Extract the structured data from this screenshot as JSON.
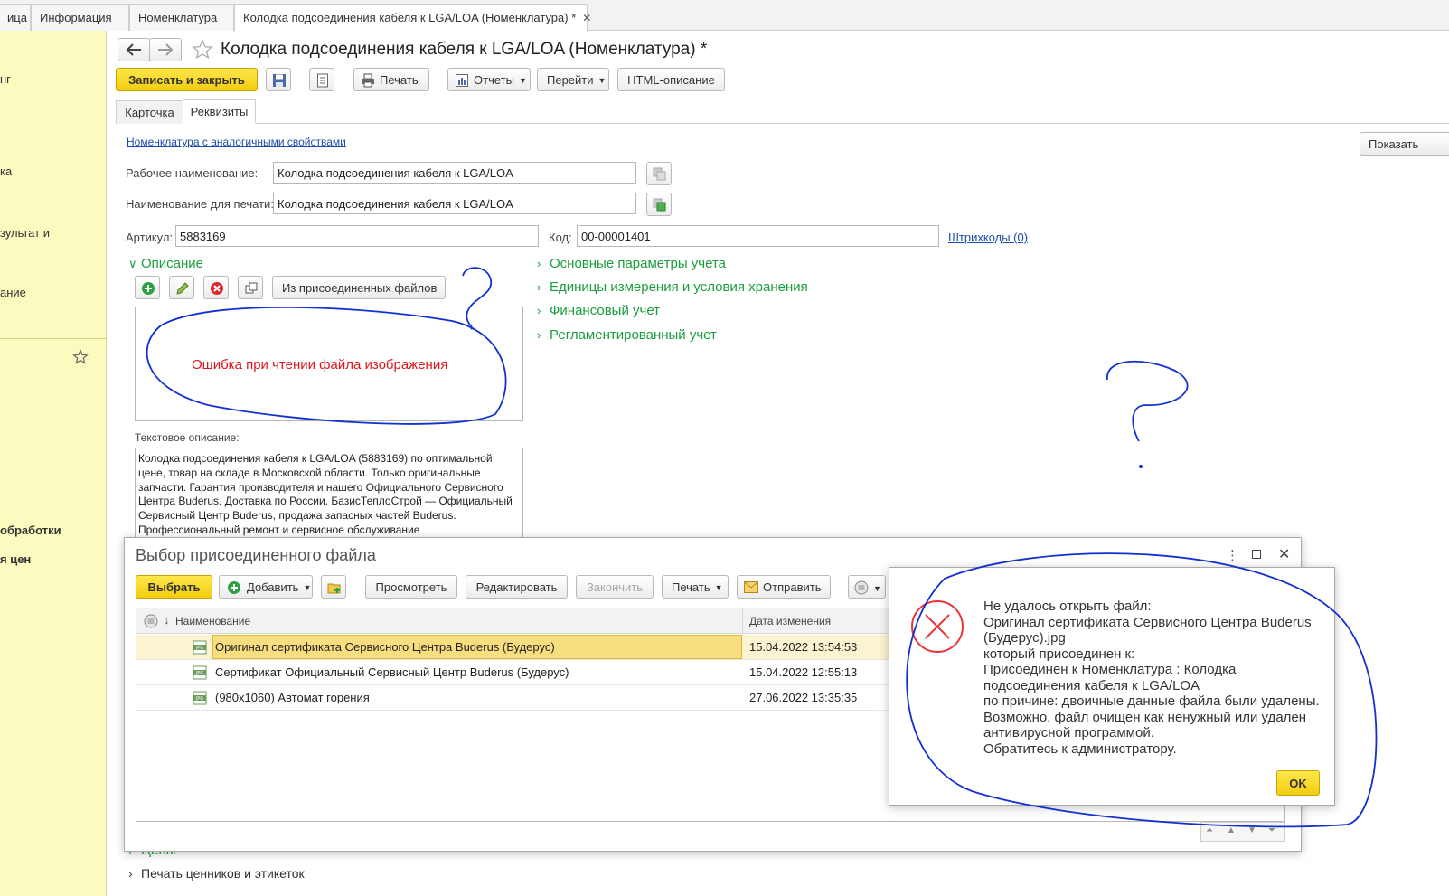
{
  "tabs": [
    {
      "label": "ица"
    },
    {
      "label": "Информация"
    },
    {
      "label": "Номенклатура"
    },
    {
      "label": "Колодка подсоединения кабеля к LGA/LOA (Номенклатура) *"
    }
  ],
  "tab_close": "✕",
  "sidebar": {
    "items": [
      "нг",
      "ка",
      "зультат и",
      "ание",
      "обработки",
      "я цен"
    ]
  },
  "window": {
    "title": "Колодка подсоединения кабеля к LGA/LOA (Номенклатура) *"
  },
  "toolbar": {
    "save_close": "Записать и закрыть",
    "print": "Печать",
    "reports": "Отчеты",
    "goto": "Перейти",
    "html": "HTML-описание"
  },
  "form_tabs": [
    "Карточка",
    "Реквизиты"
  ],
  "form": {
    "similar_link": "Номенклатура с аналогичными свойствами",
    "show_btn": "Показать",
    "work_name_label": "Рабочее наименование:",
    "work_name_value": "Колодка подсоединения кабеля к LGA/LOA",
    "print_name_label": "Наименование для печати:",
    "print_name_value": "Колодка подсоединения кабеля к LGA/LOA",
    "article_label": "Артикул:",
    "article_value": "5883169",
    "code_label": "Код:",
    "code_value": "00-00001401",
    "barcodes_link": "Штрихкоды (0)"
  },
  "description": {
    "header": "Описание",
    "attached_btn": "Из присоединенных файлов",
    "image_error": "Ошибка при чтении файла изображения",
    "text_label": "Текстовое описание:",
    "text": "Колодка подсоединения кабеля к LGA/LOA (5883169) по оптимальной цене, товар на складе в Московской области. Только оригинальные запчасти. Гарантия производителя и нашего Официального Сервисного Центра Buderus. Доставка по России. БазисТеплоСтрой — Официальный Сервисный Центр Buderus, продажа запасных частей Buderus. Профессиональный ремонт и сервисное обслуживание"
  },
  "sections": [
    "Основные параметры учета",
    "Единицы измерения и условия хранения",
    "Финансовый учет",
    "Регламентированный учет"
  ],
  "bottom_sections": [
    "Цены",
    "Печать ценников и этикеток"
  ],
  "dialog": {
    "title": "Выбор присоединенного файла",
    "select": "Выбрать",
    "add": "Добавить",
    "view": "Просмотреть",
    "edit": "Редактировать",
    "finish": "Закончить",
    "print": "Печать",
    "send": "Отправить",
    "col_name": "Наименование",
    "col_date": "Дата изменения",
    "rows": [
      {
        "name": "Оригинал сертификата Сервисного Центра Buderus (Будерус)",
        "date": "15.04.2022 13:54:53"
      },
      {
        "name": "Сертификат Официальный Сервисный Центр Buderus (Будерус)",
        "date": "15.04.2022 12:55:13"
      },
      {
        "name": "(980х1060) Автомат горения",
        "date": "27.06.2022 13:35:35"
      }
    ]
  },
  "message": {
    "text": "Не удалось открыть файл:\nОригинал сертификата Сервисного Центра Buderus (Будерус).jpg\nкоторый присоединен к:\nПрисоединен к Номенклатура : Колодка подсоединения кабеля к LGA/LOA\nпо причине: двоичные данные файла были удалены.\nВозможно, файл очищен как ненужный или удален антивирусной программой.\nОбратитесь к администратору.",
    "ok": "OK"
  },
  "colors": {
    "sidebar": "#fbfbbf",
    "accent_yellow": "#f2cc10",
    "section_green": "#1a9e3c",
    "error_red": "#e8373b",
    "ink_blue": "#1230d0"
  }
}
